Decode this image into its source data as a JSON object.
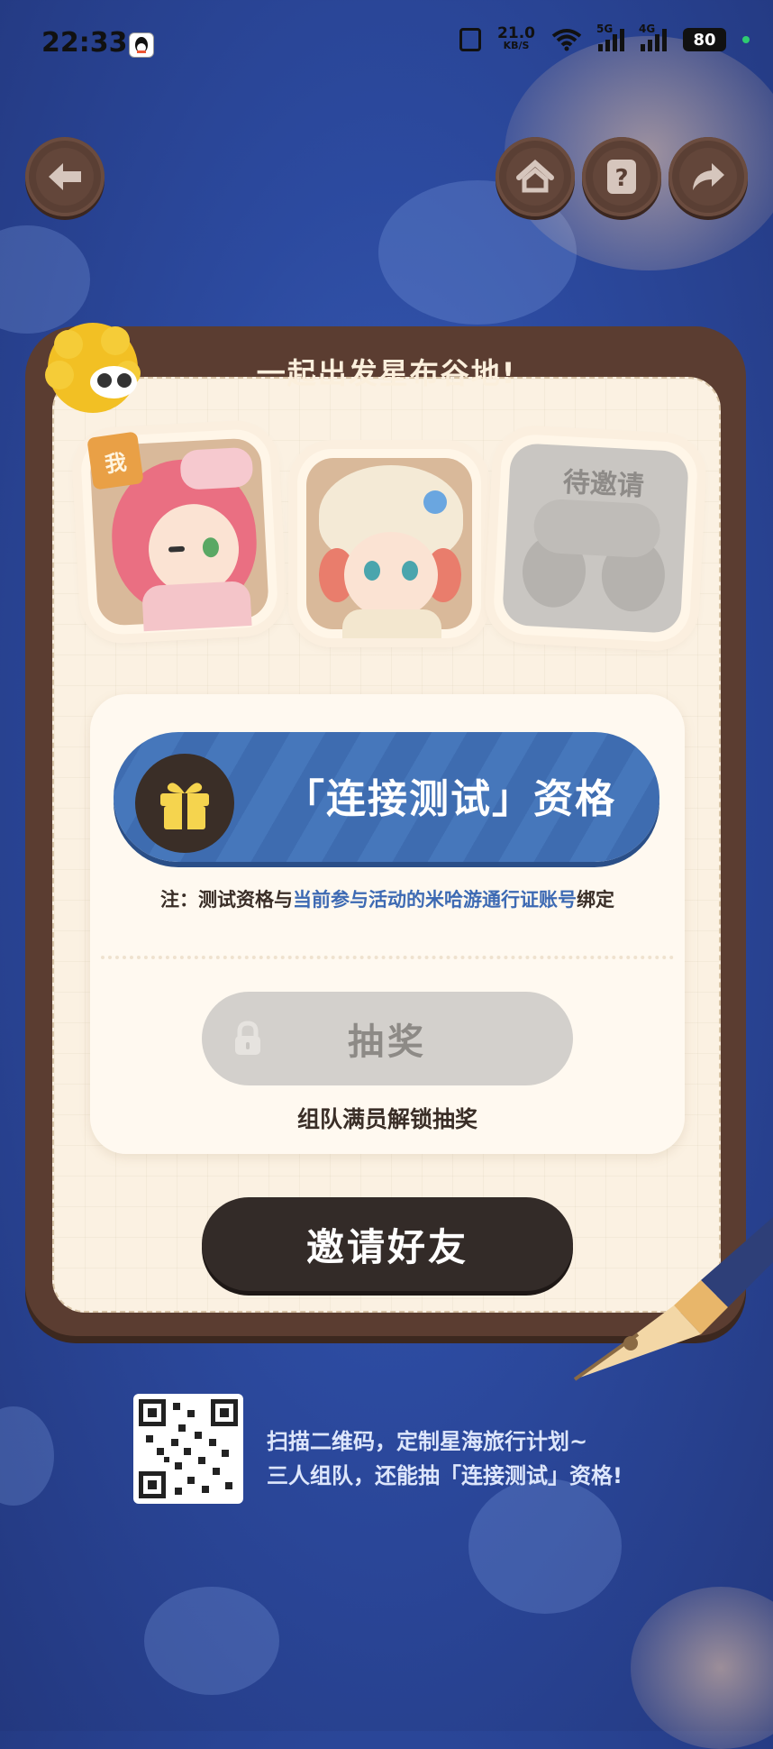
{
  "status_bar": {
    "time": "22:33",
    "net_speed": "21.0",
    "net_unit": "KB/S",
    "signal_1_label": "5G",
    "signal_2_label": "4G",
    "battery": "80"
  },
  "nav": {
    "back_icon": "arrow-left-icon",
    "home_icon": "home-icon",
    "help_icon": "question-icon",
    "share_icon": "share-arrow-icon"
  },
  "card": {
    "title": "一起出发星布谷地!",
    "me_tag": "我",
    "pending_label": "待邀请"
  },
  "reward": {
    "title": "「连接测试」资格",
    "note_prefix": "注：测试资格与",
    "note_highlight": "当前参与活动的米哈游通行证账号",
    "note_suffix": "绑定"
  },
  "draw": {
    "label": "抽奖",
    "hint": "组队满员解锁抽奖"
  },
  "invite": {
    "label": "邀请好友"
  },
  "qr": {
    "line1": "扫描二维码，定制星海旅行计划~",
    "line2": "三人组队，还能抽「连接测试」资格!"
  },
  "colors": {
    "background": "#2c4a9f",
    "card_frame": "#5b3d31",
    "card_paper": "#fbf1e2",
    "reward_blue": "#3e6cb0",
    "invite_dark": "#332b28",
    "highlight_blue": "#3d6ab3"
  }
}
